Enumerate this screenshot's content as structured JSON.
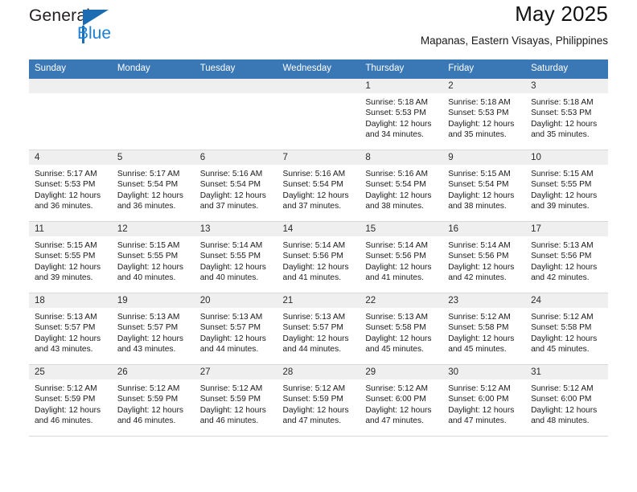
{
  "brand": {
    "name_dark": "General",
    "name_blue": "Blue",
    "accent_color": "#1b6cb3",
    "blue_text_color": "#1b7fd4"
  },
  "header": {
    "title": "May 2025",
    "subtitle": "Mapanas, Eastern Visayas, Philippines",
    "header_bg_color": "#3a77b5",
    "daynum_band_color": "#efefef"
  },
  "weekday_headers": [
    "Sunday",
    "Monday",
    "Tuesday",
    "Wednesday",
    "Thursday",
    "Friday",
    "Saturday"
  ],
  "labels": {
    "sunrise_prefix": "Sunrise:",
    "sunset_prefix": "Sunset:",
    "daylight_prefix": "Daylight:"
  },
  "weeks": [
    [
      {
        "day": "",
        "empty": true,
        "sunrise": "",
        "sunset": "",
        "daylight_line1": "",
        "daylight_line2": ""
      },
      {
        "day": "",
        "empty": true,
        "sunrise": "",
        "sunset": "",
        "daylight_line1": "",
        "daylight_line2": ""
      },
      {
        "day": "",
        "empty": true,
        "sunrise": "",
        "sunset": "",
        "daylight_line1": "",
        "daylight_line2": ""
      },
      {
        "day": "",
        "empty": true,
        "sunrise": "",
        "sunset": "",
        "daylight_line1": "",
        "daylight_line2": ""
      },
      {
        "day": "1",
        "empty": false,
        "sunrise": "Sunrise: 5:18 AM",
        "sunset": "Sunset: 5:53 PM",
        "daylight_line1": "Daylight: 12 hours",
        "daylight_line2": "and 34 minutes."
      },
      {
        "day": "2",
        "empty": false,
        "sunrise": "Sunrise: 5:18 AM",
        "sunset": "Sunset: 5:53 PM",
        "daylight_line1": "Daylight: 12 hours",
        "daylight_line2": "and 35 minutes."
      },
      {
        "day": "3",
        "empty": false,
        "sunrise": "Sunrise: 5:18 AM",
        "sunset": "Sunset: 5:53 PM",
        "daylight_line1": "Daylight: 12 hours",
        "daylight_line2": "and 35 minutes."
      }
    ],
    [
      {
        "day": "4",
        "empty": false,
        "sunrise": "Sunrise: 5:17 AM",
        "sunset": "Sunset: 5:53 PM",
        "daylight_line1": "Daylight: 12 hours",
        "daylight_line2": "and 36 minutes."
      },
      {
        "day": "5",
        "empty": false,
        "sunrise": "Sunrise: 5:17 AM",
        "sunset": "Sunset: 5:54 PM",
        "daylight_line1": "Daylight: 12 hours",
        "daylight_line2": "and 36 minutes."
      },
      {
        "day": "6",
        "empty": false,
        "sunrise": "Sunrise: 5:16 AM",
        "sunset": "Sunset: 5:54 PM",
        "daylight_line1": "Daylight: 12 hours",
        "daylight_line2": "and 37 minutes."
      },
      {
        "day": "7",
        "empty": false,
        "sunrise": "Sunrise: 5:16 AM",
        "sunset": "Sunset: 5:54 PM",
        "daylight_line1": "Daylight: 12 hours",
        "daylight_line2": "and 37 minutes."
      },
      {
        "day": "8",
        "empty": false,
        "sunrise": "Sunrise: 5:16 AM",
        "sunset": "Sunset: 5:54 PM",
        "daylight_line1": "Daylight: 12 hours",
        "daylight_line2": "and 38 minutes."
      },
      {
        "day": "9",
        "empty": false,
        "sunrise": "Sunrise: 5:15 AM",
        "sunset": "Sunset: 5:54 PM",
        "daylight_line1": "Daylight: 12 hours",
        "daylight_line2": "and 38 minutes."
      },
      {
        "day": "10",
        "empty": false,
        "sunrise": "Sunrise: 5:15 AM",
        "sunset": "Sunset: 5:55 PM",
        "daylight_line1": "Daylight: 12 hours",
        "daylight_line2": "and 39 minutes."
      }
    ],
    [
      {
        "day": "11",
        "empty": false,
        "sunrise": "Sunrise: 5:15 AM",
        "sunset": "Sunset: 5:55 PM",
        "daylight_line1": "Daylight: 12 hours",
        "daylight_line2": "and 39 minutes."
      },
      {
        "day": "12",
        "empty": false,
        "sunrise": "Sunrise: 5:15 AM",
        "sunset": "Sunset: 5:55 PM",
        "daylight_line1": "Daylight: 12 hours",
        "daylight_line2": "and 40 minutes."
      },
      {
        "day": "13",
        "empty": false,
        "sunrise": "Sunrise: 5:14 AM",
        "sunset": "Sunset: 5:55 PM",
        "daylight_line1": "Daylight: 12 hours",
        "daylight_line2": "and 40 minutes."
      },
      {
        "day": "14",
        "empty": false,
        "sunrise": "Sunrise: 5:14 AM",
        "sunset": "Sunset: 5:56 PM",
        "daylight_line1": "Daylight: 12 hours",
        "daylight_line2": "and 41 minutes."
      },
      {
        "day": "15",
        "empty": false,
        "sunrise": "Sunrise: 5:14 AM",
        "sunset": "Sunset: 5:56 PM",
        "daylight_line1": "Daylight: 12 hours",
        "daylight_line2": "and 41 minutes."
      },
      {
        "day": "16",
        "empty": false,
        "sunrise": "Sunrise: 5:14 AM",
        "sunset": "Sunset: 5:56 PM",
        "daylight_line1": "Daylight: 12 hours",
        "daylight_line2": "and 42 minutes."
      },
      {
        "day": "17",
        "empty": false,
        "sunrise": "Sunrise: 5:13 AM",
        "sunset": "Sunset: 5:56 PM",
        "daylight_line1": "Daylight: 12 hours",
        "daylight_line2": "and 42 minutes."
      }
    ],
    [
      {
        "day": "18",
        "empty": false,
        "sunrise": "Sunrise: 5:13 AM",
        "sunset": "Sunset: 5:57 PM",
        "daylight_line1": "Daylight: 12 hours",
        "daylight_line2": "and 43 minutes."
      },
      {
        "day": "19",
        "empty": false,
        "sunrise": "Sunrise: 5:13 AM",
        "sunset": "Sunset: 5:57 PM",
        "daylight_line1": "Daylight: 12 hours",
        "daylight_line2": "and 43 minutes."
      },
      {
        "day": "20",
        "empty": false,
        "sunrise": "Sunrise: 5:13 AM",
        "sunset": "Sunset: 5:57 PM",
        "daylight_line1": "Daylight: 12 hours",
        "daylight_line2": "and 44 minutes."
      },
      {
        "day": "21",
        "empty": false,
        "sunrise": "Sunrise: 5:13 AM",
        "sunset": "Sunset: 5:57 PM",
        "daylight_line1": "Daylight: 12 hours",
        "daylight_line2": "and 44 minutes."
      },
      {
        "day": "22",
        "empty": false,
        "sunrise": "Sunrise: 5:13 AM",
        "sunset": "Sunset: 5:58 PM",
        "daylight_line1": "Daylight: 12 hours",
        "daylight_line2": "and 45 minutes."
      },
      {
        "day": "23",
        "empty": false,
        "sunrise": "Sunrise: 5:12 AM",
        "sunset": "Sunset: 5:58 PM",
        "daylight_line1": "Daylight: 12 hours",
        "daylight_line2": "and 45 minutes."
      },
      {
        "day": "24",
        "empty": false,
        "sunrise": "Sunrise: 5:12 AM",
        "sunset": "Sunset: 5:58 PM",
        "daylight_line1": "Daylight: 12 hours",
        "daylight_line2": "and 45 minutes."
      }
    ],
    [
      {
        "day": "25",
        "empty": false,
        "sunrise": "Sunrise: 5:12 AM",
        "sunset": "Sunset: 5:59 PM",
        "daylight_line1": "Daylight: 12 hours",
        "daylight_line2": "and 46 minutes."
      },
      {
        "day": "26",
        "empty": false,
        "sunrise": "Sunrise: 5:12 AM",
        "sunset": "Sunset: 5:59 PM",
        "daylight_line1": "Daylight: 12 hours",
        "daylight_line2": "and 46 minutes."
      },
      {
        "day": "27",
        "empty": false,
        "sunrise": "Sunrise: 5:12 AM",
        "sunset": "Sunset: 5:59 PM",
        "daylight_line1": "Daylight: 12 hours",
        "daylight_line2": "and 46 minutes."
      },
      {
        "day": "28",
        "empty": false,
        "sunrise": "Sunrise: 5:12 AM",
        "sunset": "Sunset: 5:59 PM",
        "daylight_line1": "Daylight: 12 hours",
        "daylight_line2": "and 47 minutes."
      },
      {
        "day": "29",
        "empty": false,
        "sunrise": "Sunrise: 5:12 AM",
        "sunset": "Sunset: 6:00 PM",
        "daylight_line1": "Daylight: 12 hours",
        "daylight_line2": "and 47 minutes."
      },
      {
        "day": "30",
        "empty": false,
        "sunrise": "Sunrise: 5:12 AM",
        "sunset": "Sunset: 6:00 PM",
        "daylight_line1": "Daylight: 12 hours",
        "daylight_line2": "and 47 minutes."
      },
      {
        "day": "31",
        "empty": false,
        "sunrise": "Sunrise: 5:12 AM",
        "sunset": "Sunset: 6:00 PM",
        "daylight_line1": "Daylight: 12 hours",
        "daylight_line2": "and 48 minutes."
      }
    ]
  ]
}
